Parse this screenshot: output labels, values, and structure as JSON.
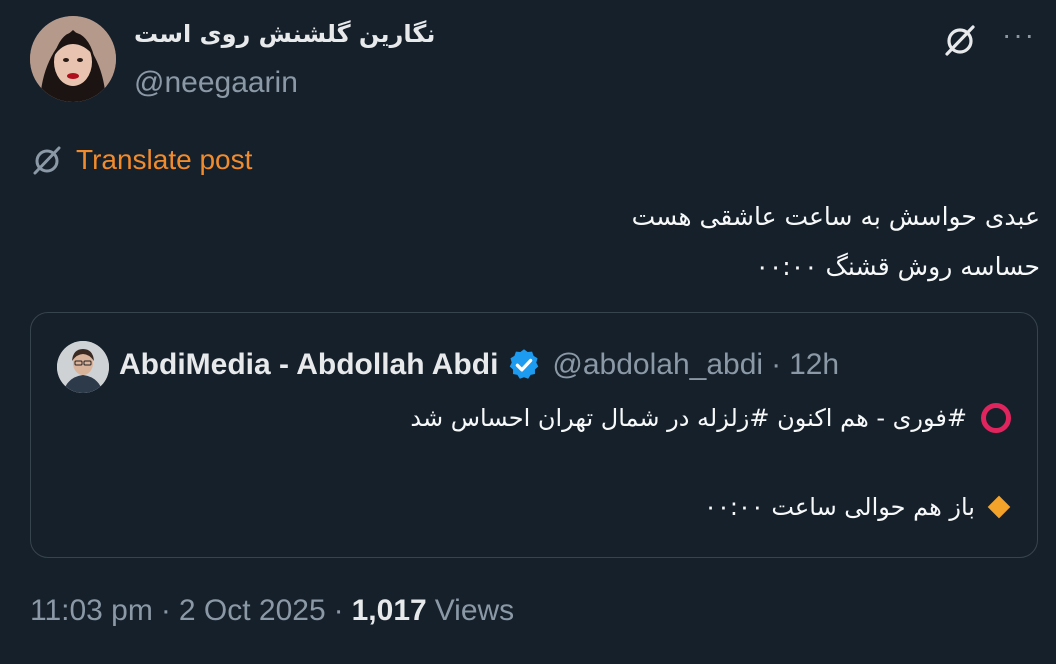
{
  "author": {
    "name": "نگارین گلشنش روی است",
    "handle": "@neegaarin"
  },
  "header": {
    "grok_icon": "grok-slash-circle-icon",
    "more_icon": "more-dots-icon",
    "more_label": "···"
  },
  "translate": {
    "label": "Translate post",
    "icon": "translate-icon",
    "color": "#f28b2b"
  },
  "post": {
    "lines": [
      "عبدی حواسش به ساعت عاشقی هست",
      "حساسه روش قشنگ ۰۰:۰۰"
    ]
  },
  "quote": {
    "name": "AbdiMedia - Abdollah Abdi",
    "verified_icon": "verified-badge-icon",
    "handle": "@abdolah_abdi",
    "separator": "·",
    "time": "12h",
    "line1": "#فوری - هم اکنون #زلزله در شمال تهران احساس شد",
    "line2": "باز هم حوالی ساعت ۰۰:۰۰",
    "line1_icon": "red-circle-icon",
    "line2_icon": "orange-diamond-icon"
  },
  "footer": {
    "time": "11:03 pm",
    "separator": "·",
    "date": "2 Oct 2025",
    "views_count": "1,017",
    "views_label": "Views"
  },
  "colors": {
    "background": "#15202b",
    "border": "#38444d",
    "muted": "#8b98a5",
    "verified": "#1d9bf0"
  }
}
